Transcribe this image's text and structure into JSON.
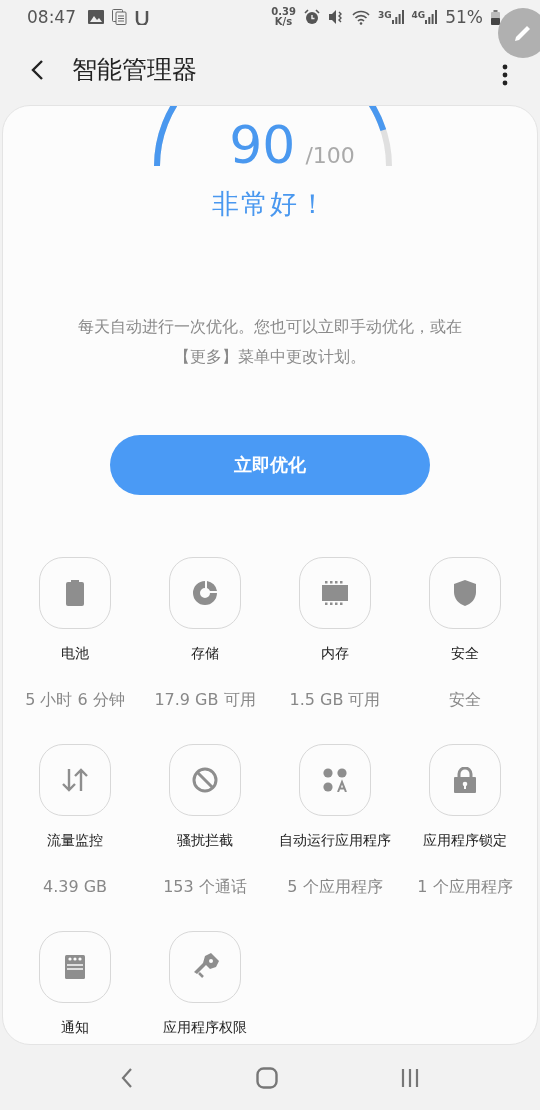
{
  "status_bar": {
    "time": "08:47",
    "net_speed": "0.39",
    "net_unit": "K/s",
    "networks": [
      "3G",
      "4G"
    ],
    "battery": "51%"
  },
  "app_bar": {
    "title": "智能管理器"
  },
  "score": {
    "value": "90",
    "max": "/100",
    "rating": "非常好！"
  },
  "description": "每天自动进行一次优化。您也可以立即手动优化，或在【更多】菜单中更改计划。",
  "optimize_button": "立即优化",
  "tools": [
    {
      "kind": "battery",
      "label": "电池",
      "value": "5 小时 6 分钟"
    },
    {
      "kind": "storage",
      "label": "存储",
      "value": "17.9 GB 可用"
    },
    {
      "kind": "memory",
      "label": "内存",
      "value": "1.5 GB 可用"
    },
    {
      "kind": "security",
      "label": "安全",
      "value": "安全"
    },
    {
      "kind": "data",
      "label": "流量监控",
      "value": "4.39 GB"
    },
    {
      "kind": "block",
      "label": "骚扰拦截",
      "value": "153 个通话"
    },
    {
      "kind": "autorun",
      "label": "自动运行应用程序",
      "value": "5 个应用程序"
    },
    {
      "kind": "lock",
      "label": "应用程序锁定",
      "value": "1 个应用程序"
    },
    {
      "kind": "notification",
      "label": "通知"
    },
    {
      "kind": "permission",
      "label": "应用程序权限"
    }
  ]
}
